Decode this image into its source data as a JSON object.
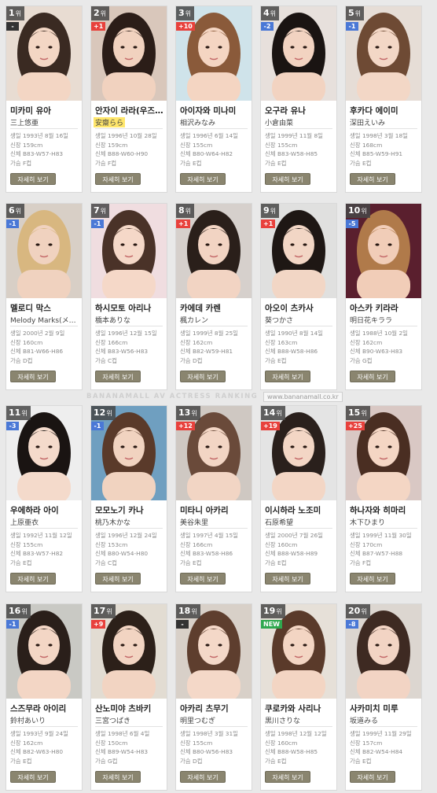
{
  "watermark": "BANANAMALL AV ACTRESS RANKING",
  "watermark_site": "www.bananamall.co.kr",
  "rank_suffix": "위",
  "button_label": "자세히 보기",
  "change_colors": {
    "up": "#e8413c",
    "down": "#4a78d6",
    "same": "#333333",
    "new": "#2fa84f"
  },
  "actresses": [
    {
      "rank": "1",
      "change": "-",
      "change_type": "same",
      "kname": "미카미 유아",
      "jname": "三上悠亜",
      "birth": "생일 1993년 8월 16일",
      "height": "신장 159cm",
      "size": "신체 B83-W57-H83",
      "cup": "가슴 F컵",
      "hair": "#3a2a22",
      "bg": "#e8dcd2",
      "skin": "#f3d6c4"
    },
    {
      "rank": "2",
      "change": "+1",
      "change_type": "up",
      "kname": "안자이 라라(우즈…",
      "jname": "安齋らら",
      "jname_highlight": true,
      "birth": "생일 1996년 10월 28일",
      "height": "신장 159cm",
      "size": "신체 B88-W60-H90",
      "cup": "가슴 F컵",
      "hair": "#2b1d18",
      "bg": "#d9c7bb",
      "skin": "#f1d2bf"
    },
    {
      "rank": "3",
      "change": "+10",
      "change_type": "up",
      "kname": "아이자와 미나미",
      "jname": "相沢みなみ",
      "birth": "생일 1996년 6월 14일",
      "height": "신장 155cm",
      "size": "신체 B80-W64-H82",
      "cup": "가슴 E컵",
      "hair": "#8a5a3a",
      "bg": "#cfe3ea",
      "skin": "#f4d5c2"
    },
    {
      "rank": "4",
      "change": "-2",
      "change_type": "down",
      "kname": "오구라 유나",
      "jname": "小倉由菜",
      "birth": "생일 1999년 11월 8일",
      "height": "신장 155cm",
      "size": "신체 B83-W58-H85",
      "cup": "가슴 E컵",
      "hair": "#1a1412",
      "bg": "#e7e0dc",
      "skin": "#f2d3c1"
    },
    {
      "rank": "5",
      "change": "-1",
      "change_type": "down",
      "kname": "후카다 에이미",
      "jname": "深田えいみ",
      "birth": "생일 1998년 3월 18일",
      "height": "신장 168cm",
      "size": "신체 B85-W59-H91",
      "cup": "가슴 E컵",
      "hair": "#6e4a34",
      "bg": "#e6ddd6",
      "skin": "#f3d7c6"
    },
    {
      "rank": "6",
      "change": "-1",
      "change_type": "down",
      "kname": "멜로디 막스",
      "jname": "Melody Marks(メ…",
      "birth": "생일 2000년 2월 9일",
      "height": "신장 160cm",
      "size": "신체 B81-W66-H86",
      "cup": "가슴 D컵",
      "hair": "#d8b780",
      "bg": "#d8cfc6",
      "skin": "#f0d2bf"
    },
    {
      "rank": "7",
      "change": "-1",
      "change_type": "down",
      "kname": "하시모토 아리나",
      "jname": "橋本ありな",
      "birth": "생일 1996년 12월 15일",
      "height": "신장 166cm",
      "size": "신체 B83-W56-H83",
      "cup": "가슴 C컵",
      "hair": "#4a3228",
      "bg": "#f0dde0",
      "skin": "#f5d8c8"
    },
    {
      "rank": "8",
      "change": "+1",
      "change_type": "up",
      "kname": "카에데 카렌",
      "jname": "楓カレン",
      "birth": "생일 1999년 8월 25일",
      "height": "신장 162cm",
      "size": "신체 B82-W59-H81",
      "cup": "가슴 D컵",
      "hair": "#2a1f1a",
      "bg": "#d6d0cc",
      "skin": "#f2d4c3"
    },
    {
      "rank": "9",
      "change": "+1",
      "change_type": "up",
      "kname": "아오이 츠카사",
      "jname": "葵つかさ",
      "birth": "생일 1990년 8월 14일",
      "height": "신장 163cm",
      "size": "신체 B88-W58-H86",
      "cup": "가슴 E컵",
      "hair": "#1e1714",
      "bg": "#e0e0df",
      "skin": "#f2d6c5"
    },
    {
      "rank": "10",
      "change": "-5",
      "change_type": "down",
      "kname": "아스카 키라라",
      "jname": "明日花キララ",
      "birth": "생일 1988년 10월 2일",
      "height": "신장 162cm",
      "size": "신체 B90-W63-H83",
      "cup": "가슴 G컵",
      "hair": "#b07a4a",
      "bg": "#5a1f2e",
      "skin": "#f1cdb8"
    },
    {
      "rank": "11",
      "change": "-3",
      "change_type": "down",
      "kname": "우에하라 아이",
      "jname": "上原亜衣",
      "birth": "생일 1992년 11월 12일",
      "height": "신장 155cm",
      "size": "신체 B83-W57-H82",
      "cup": "가슴 E컵",
      "hair": "#1a1412",
      "bg": "#eeeeee",
      "skin": "#f4dacb"
    },
    {
      "rank": "12",
      "change": "-1",
      "change_type": "down",
      "kname": "모모노기 카나",
      "jname": "桃乃木かな",
      "birth": "생일 1996년 12월 24일",
      "height": "신장 153cm",
      "size": "신체 B80-W54-H80",
      "cup": "가슴 C컵",
      "hair": "#5a3a2a",
      "bg": "#6f9fc0",
      "skin": "#f1d3c0"
    },
    {
      "rank": "13",
      "change": "+12",
      "change_type": "up",
      "kname": "미타니 아카리",
      "jname": "美谷朱里",
      "birth": "생일 1997년 4월 15일",
      "height": "신장 166cm",
      "size": "신체 B83-W58-H86",
      "cup": "가슴 E컵",
      "hair": "#6a4a3a",
      "bg": "#cfc8c2",
      "skin": "#f2d5c4"
    },
    {
      "rank": "14",
      "change": "+19",
      "change_type": "up",
      "kname": "이시하라 노조미",
      "jname": "石原希望",
      "birth": "생일 2000년 7월 26일",
      "height": "신장 160cm",
      "size": "신체 B88-W58-H89",
      "cup": "가슴 E컵",
      "hair": "#2a201c",
      "bg": "#e4e4e4",
      "skin": "#f3d6c5"
    },
    {
      "rank": "15",
      "change": "+25",
      "change_type": "up",
      "kname": "하나자와 히마리",
      "jname": "木下ひまり",
      "birth": "생일 1999년 11월 30일",
      "height": "신장 170cm",
      "size": "신체 B87-W57-H88",
      "cup": "가슴 F컵",
      "hair": "#4a2e22",
      "bg": "#d9c8c4",
      "skin": "#f4d6c4"
    },
    {
      "rank": "16",
      "change": "-1",
      "change_type": "down",
      "kname": "스즈무라 아이리",
      "jname": "鈴村あいり",
      "birth": "생일 1993년 9월 24일",
      "height": "신장 162cm",
      "size": "신체 B82-W63-H80",
      "cup": "가슴 E컵",
      "hair": "#2a1f1a",
      "bg": "#c9c9c4",
      "skin": "#f3d6c5"
    },
    {
      "rank": "17",
      "change": "+9",
      "change_type": "up",
      "kname": "산노미야 츠바키",
      "jname": "三宮つばき",
      "birth": "생일 1998년 6월 4일",
      "height": "신장 150cm",
      "size": "신체 B89-W54-H83",
      "cup": "가슴 G컵",
      "hair": "#2c2019",
      "bg": "#e2dcd2",
      "skin": "#f2d4c2"
    },
    {
      "rank": "18",
      "change": "-",
      "change_type": "same",
      "kname": "아카리 츠무기",
      "jname": "明里つむぎ",
      "birth": "생일 1998년 3월 31일",
      "height": "신장 155cm",
      "size": "신체 B80-W56-H83",
      "cup": "가슴 D컵",
      "hair": "#5e3e2e",
      "bg": "#d8d0c8",
      "skin": "#f4d8c8"
    },
    {
      "rank": "19",
      "change": "NEW",
      "change_type": "new",
      "kname": "쿠로카와 사리나",
      "jname": "黒川さりな",
      "birth": "생일 1998년 12월 12일",
      "height": "신장 160cm",
      "size": "신체 B88-W58-H85",
      "cup": "가슴 E컵",
      "hair": "#5a3a2a",
      "bg": "#e6e0d8",
      "skin": "#f3d5c3"
    },
    {
      "rank": "20",
      "change": "-8",
      "change_type": "down",
      "kname": "사카미치 미루",
      "jname": "坂道みる",
      "birth": "생일 1999년 11월 29일",
      "height": "신장 157cm",
      "size": "신체 B82-W54-H84",
      "cup": "가슴 E컵",
      "hair": "#3e2a22",
      "bg": "#dcd6d0",
      "skin": "#f2d4c4"
    }
  ]
}
